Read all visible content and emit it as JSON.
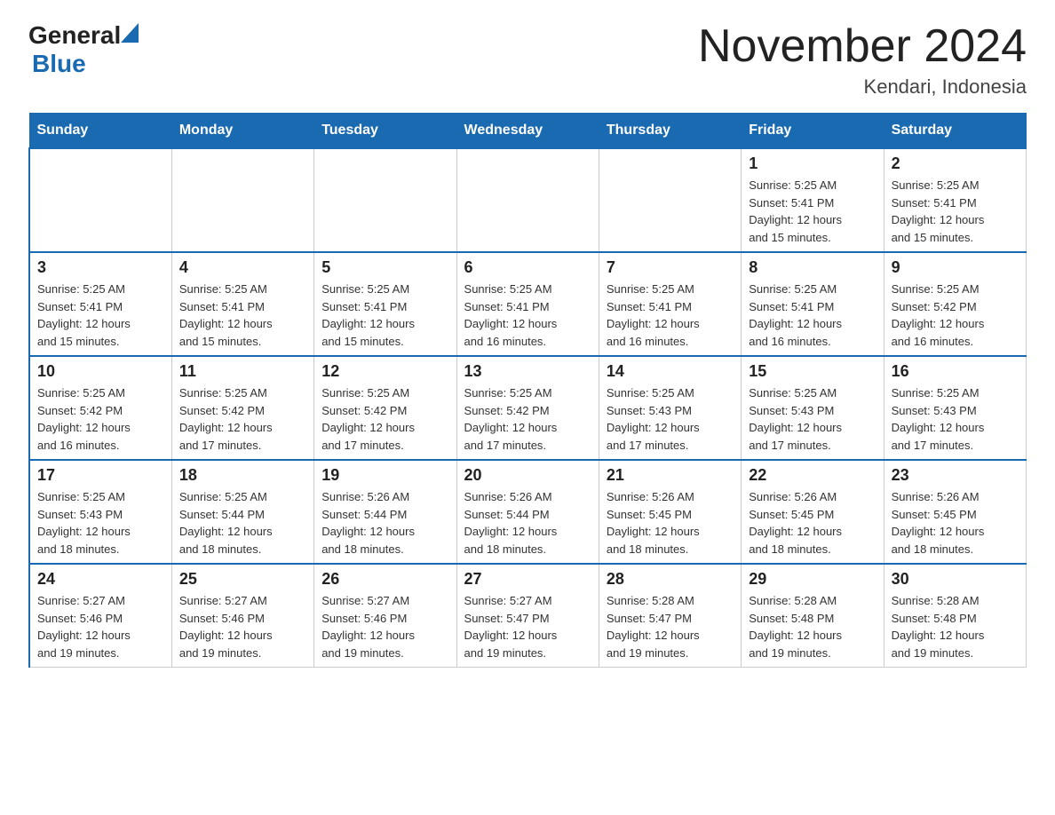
{
  "header": {
    "logo_general": "General",
    "logo_blue": "Blue",
    "month_title": "November 2024",
    "location": "Kendari, Indonesia"
  },
  "weekdays": [
    "Sunday",
    "Monday",
    "Tuesday",
    "Wednesday",
    "Thursday",
    "Friday",
    "Saturday"
  ],
  "weeks": [
    [
      {
        "day": "",
        "info": ""
      },
      {
        "day": "",
        "info": ""
      },
      {
        "day": "",
        "info": ""
      },
      {
        "day": "",
        "info": ""
      },
      {
        "day": "",
        "info": ""
      },
      {
        "day": "1",
        "info": "Sunrise: 5:25 AM\nSunset: 5:41 PM\nDaylight: 12 hours\nand 15 minutes."
      },
      {
        "day": "2",
        "info": "Sunrise: 5:25 AM\nSunset: 5:41 PM\nDaylight: 12 hours\nand 15 minutes."
      }
    ],
    [
      {
        "day": "3",
        "info": "Sunrise: 5:25 AM\nSunset: 5:41 PM\nDaylight: 12 hours\nand 15 minutes."
      },
      {
        "day": "4",
        "info": "Sunrise: 5:25 AM\nSunset: 5:41 PM\nDaylight: 12 hours\nand 15 minutes."
      },
      {
        "day": "5",
        "info": "Sunrise: 5:25 AM\nSunset: 5:41 PM\nDaylight: 12 hours\nand 15 minutes."
      },
      {
        "day": "6",
        "info": "Sunrise: 5:25 AM\nSunset: 5:41 PM\nDaylight: 12 hours\nand 16 minutes."
      },
      {
        "day": "7",
        "info": "Sunrise: 5:25 AM\nSunset: 5:41 PM\nDaylight: 12 hours\nand 16 minutes."
      },
      {
        "day": "8",
        "info": "Sunrise: 5:25 AM\nSunset: 5:41 PM\nDaylight: 12 hours\nand 16 minutes."
      },
      {
        "day": "9",
        "info": "Sunrise: 5:25 AM\nSunset: 5:42 PM\nDaylight: 12 hours\nand 16 minutes."
      }
    ],
    [
      {
        "day": "10",
        "info": "Sunrise: 5:25 AM\nSunset: 5:42 PM\nDaylight: 12 hours\nand 16 minutes."
      },
      {
        "day": "11",
        "info": "Sunrise: 5:25 AM\nSunset: 5:42 PM\nDaylight: 12 hours\nand 17 minutes."
      },
      {
        "day": "12",
        "info": "Sunrise: 5:25 AM\nSunset: 5:42 PM\nDaylight: 12 hours\nand 17 minutes."
      },
      {
        "day": "13",
        "info": "Sunrise: 5:25 AM\nSunset: 5:42 PM\nDaylight: 12 hours\nand 17 minutes."
      },
      {
        "day": "14",
        "info": "Sunrise: 5:25 AM\nSunset: 5:43 PM\nDaylight: 12 hours\nand 17 minutes."
      },
      {
        "day": "15",
        "info": "Sunrise: 5:25 AM\nSunset: 5:43 PM\nDaylight: 12 hours\nand 17 minutes."
      },
      {
        "day": "16",
        "info": "Sunrise: 5:25 AM\nSunset: 5:43 PM\nDaylight: 12 hours\nand 17 minutes."
      }
    ],
    [
      {
        "day": "17",
        "info": "Sunrise: 5:25 AM\nSunset: 5:43 PM\nDaylight: 12 hours\nand 18 minutes."
      },
      {
        "day": "18",
        "info": "Sunrise: 5:25 AM\nSunset: 5:44 PM\nDaylight: 12 hours\nand 18 minutes."
      },
      {
        "day": "19",
        "info": "Sunrise: 5:26 AM\nSunset: 5:44 PM\nDaylight: 12 hours\nand 18 minutes."
      },
      {
        "day": "20",
        "info": "Sunrise: 5:26 AM\nSunset: 5:44 PM\nDaylight: 12 hours\nand 18 minutes."
      },
      {
        "day": "21",
        "info": "Sunrise: 5:26 AM\nSunset: 5:45 PM\nDaylight: 12 hours\nand 18 minutes."
      },
      {
        "day": "22",
        "info": "Sunrise: 5:26 AM\nSunset: 5:45 PM\nDaylight: 12 hours\nand 18 minutes."
      },
      {
        "day": "23",
        "info": "Sunrise: 5:26 AM\nSunset: 5:45 PM\nDaylight: 12 hours\nand 18 minutes."
      }
    ],
    [
      {
        "day": "24",
        "info": "Sunrise: 5:27 AM\nSunset: 5:46 PM\nDaylight: 12 hours\nand 19 minutes."
      },
      {
        "day": "25",
        "info": "Sunrise: 5:27 AM\nSunset: 5:46 PM\nDaylight: 12 hours\nand 19 minutes."
      },
      {
        "day": "26",
        "info": "Sunrise: 5:27 AM\nSunset: 5:46 PM\nDaylight: 12 hours\nand 19 minutes."
      },
      {
        "day": "27",
        "info": "Sunrise: 5:27 AM\nSunset: 5:47 PM\nDaylight: 12 hours\nand 19 minutes."
      },
      {
        "day": "28",
        "info": "Sunrise: 5:28 AM\nSunset: 5:47 PM\nDaylight: 12 hours\nand 19 minutes."
      },
      {
        "day": "29",
        "info": "Sunrise: 5:28 AM\nSunset: 5:48 PM\nDaylight: 12 hours\nand 19 minutes."
      },
      {
        "day": "30",
        "info": "Sunrise: 5:28 AM\nSunset: 5:48 PM\nDaylight: 12 hours\nand 19 minutes."
      }
    ]
  ]
}
